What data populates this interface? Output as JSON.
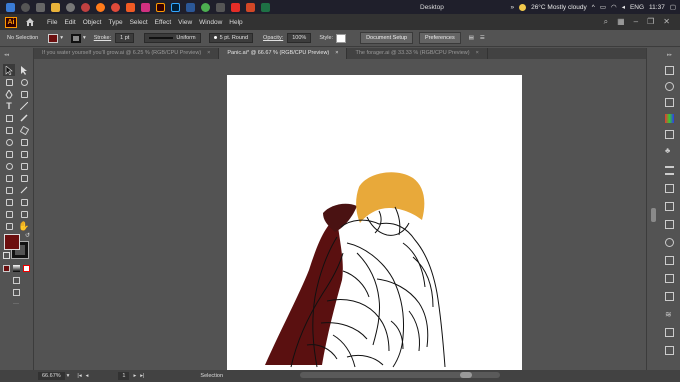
{
  "taskbar": {
    "desktop_label": "Desktop",
    "weather": "26°C  Mostly cloudy",
    "language": "ENG",
    "time": "11:37"
  },
  "menubar": {
    "app_logo": "Ai",
    "items": [
      "File",
      "Edit",
      "Object",
      "Type",
      "Select",
      "Effect",
      "View",
      "Window",
      "Help"
    ]
  },
  "controlbar": {
    "selection_status": "No Selection",
    "stroke_label": "Stroke:",
    "stroke_weight": "1 pt",
    "profile": "Uniform",
    "brush": "5 pt. Round",
    "opacity_label": "Opacity:",
    "opacity_value": "100%",
    "style_label": "Style:",
    "document_setup_label": "Document Setup",
    "preferences_label": "Preferences"
  },
  "doc_tabs": [
    {
      "label": "If you water yourself you'll grow.ai @ 6.25 % (RGB/CPU Preview)",
      "close": "×",
      "active": false
    },
    {
      "label": "Panic.ai* @ 66.67 % (RGB/CPU Preview)",
      "close": "×",
      "active": true
    },
    {
      "label": "The forager.ai @ 33.33 % (RGB/CPU Preview)",
      "close": "×",
      "active": false
    }
  ],
  "colors": {
    "fill": "#6b0e0e",
    "stroke": "#111111",
    "hair": "#e8a93a",
    "accent": "#ff9a00"
  },
  "statusbar": {
    "zoom": "66.67%",
    "page": "1",
    "current_tool": "Selection"
  }
}
